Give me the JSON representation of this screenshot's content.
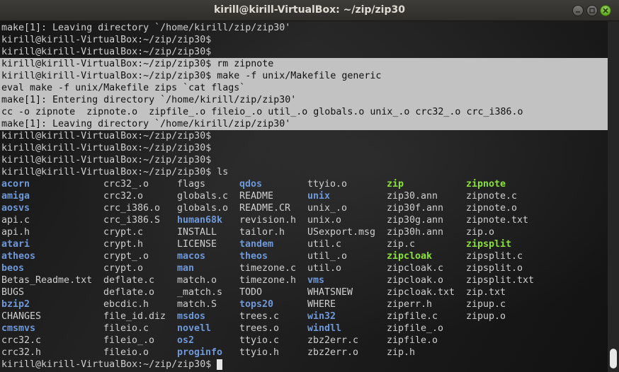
{
  "window": {
    "title": "kirill@kirill-VirtualBox: ~/zip/zip30"
  },
  "colors": {
    "directory": "#6f99d9",
    "executable": "#8ae234",
    "selection": "#c2c2c2"
  },
  "terminal": {
    "lines_before": [
      {
        "text": "make[1]: Leaving directory `/home/kirill/zip/zip30'",
        "selected": false
      },
      {
        "text": "kirill@kirill-VirtualBox:~/zip/zip30$",
        "selected": false
      },
      {
        "text": "kirill@kirill-VirtualBox:~/zip/zip30$",
        "selected": false
      },
      {
        "text": "kirill@kirill-VirtualBox:~/zip/zip30$ rm zipnote",
        "selected": true
      },
      {
        "text": "kirill@kirill-VirtualBox:~/zip/zip30$ make -f unix/Makefile generic",
        "selected": true
      },
      {
        "text": "eval make -f unix/Makefile zips `cat flags`",
        "selected": true
      },
      {
        "text": "make[1]: Entering directory `/home/kirill/zip/zip30'",
        "selected": true
      },
      {
        "text": "cc -o zipnote  zipnote.o  zipfile_.o fileio_.o util_.o globals.o unix_.o crc32_.o crc_i386.o",
        "selected": true
      },
      {
        "text": "make[1]: Leaving directory `/home/kirill/zip/zip30'",
        "selected": true
      },
      {
        "text": "kirill@kirill-VirtualBox:~/zip/zip30$",
        "selected": false
      },
      {
        "text": "kirill@kirill-VirtualBox:~/zip/zip30$",
        "selected": false
      },
      {
        "text": "kirill@kirill-VirtualBox:~/zip/zip30$",
        "selected": false
      },
      {
        "text": "kirill@kirill-VirtualBox:~/zip/zip30$ ls",
        "selected": false
      }
    ],
    "ls_rows": [
      [
        {
          "t": "acorn",
          "k": "dir"
        },
        {
          "t": "crc32_.o",
          "k": "file"
        },
        {
          "t": "flags",
          "k": "file"
        },
        {
          "t": "qdos",
          "k": "dir"
        },
        {
          "t": "ttyio.o",
          "k": "file"
        },
        {
          "t": "zip",
          "k": "exe"
        },
        {
          "t": "zipnote",
          "k": "exe"
        }
      ],
      [
        {
          "t": "amiga",
          "k": "dir"
        },
        {
          "t": "crc32.o",
          "k": "file"
        },
        {
          "t": "globals.c",
          "k": "file"
        },
        {
          "t": "README",
          "k": "file"
        },
        {
          "t": "unix",
          "k": "dir"
        },
        {
          "t": "zip30.ann",
          "k": "file"
        },
        {
          "t": "zipnote.c",
          "k": "file"
        }
      ],
      [
        {
          "t": "aosvs",
          "k": "dir"
        },
        {
          "t": "crc_i386.o",
          "k": "file"
        },
        {
          "t": "globals.o",
          "k": "file"
        },
        {
          "t": "README.CR",
          "k": "file"
        },
        {
          "t": "unix_.o",
          "k": "file"
        },
        {
          "t": "zip30f.ann",
          "k": "file"
        },
        {
          "t": "zipnote.o",
          "k": "file"
        }
      ],
      [
        {
          "t": "api.c",
          "k": "file"
        },
        {
          "t": "crc_i386.S",
          "k": "file"
        },
        {
          "t": "human68k",
          "k": "dir"
        },
        {
          "t": "revision.h",
          "k": "file"
        },
        {
          "t": "unix.o",
          "k": "file"
        },
        {
          "t": "zip30g.ann",
          "k": "file"
        },
        {
          "t": "zipnote.txt",
          "k": "file"
        }
      ],
      [
        {
          "t": "api.h",
          "k": "file"
        },
        {
          "t": "crypt.c",
          "k": "file"
        },
        {
          "t": "INSTALL",
          "k": "file"
        },
        {
          "t": "tailor.h",
          "k": "file"
        },
        {
          "t": "USexport.msg",
          "k": "file"
        },
        {
          "t": "zip30h.ann",
          "k": "file"
        },
        {
          "t": "zip.o",
          "k": "file"
        }
      ],
      [
        {
          "t": "atari",
          "k": "dir"
        },
        {
          "t": "crypt.h",
          "k": "file"
        },
        {
          "t": "LICENSE",
          "k": "file"
        },
        {
          "t": "tandem",
          "k": "dir"
        },
        {
          "t": "util.c",
          "k": "file"
        },
        {
          "t": "zip.c",
          "k": "file"
        },
        {
          "t": "zipsplit",
          "k": "exe"
        }
      ],
      [
        {
          "t": "atheos",
          "k": "dir"
        },
        {
          "t": "crypt_.o",
          "k": "file"
        },
        {
          "t": "macos",
          "k": "dir"
        },
        {
          "t": "theos",
          "k": "dir"
        },
        {
          "t": "util_.o",
          "k": "file"
        },
        {
          "t": "zipcloak",
          "k": "exe"
        },
        {
          "t": "zipsplit.c",
          "k": "file"
        }
      ],
      [
        {
          "t": "beos",
          "k": "dir"
        },
        {
          "t": "crypt.o",
          "k": "file"
        },
        {
          "t": "man",
          "k": "dir"
        },
        {
          "t": "timezone.c",
          "k": "file"
        },
        {
          "t": "util.o",
          "k": "file"
        },
        {
          "t": "zipcloak.c",
          "k": "file"
        },
        {
          "t": "zipsplit.o",
          "k": "file"
        }
      ],
      [
        {
          "t": "Betas_Readme.txt",
          "k": "file"
        },
        {
          "t": "deflate.c",
          "k": "file"
        },
        {
          "t": "match.o",
          "k": "file"
        },
        {
          "t": "timezone.h",
          "k": "file"
        },
        {
          "t": "vms",
          "k": "dir"
        },
        {
          "t": "zipcloak.o",
          "k": "file"
        },
        {
          "t": "zipsplit.txt",
          "k": "file"
        }
      ],
      [
        {
          "t": "BUGS",
          "k": "file"
        },
        {
          "t": "deflate.o",
          "k": "file"
        },
        {
          "t": "_match.s",
          "k": "file"
        },
        {
          "t": "TODO",
          "k": "file"
        },
        {
          "t": "WHATSNEW",
          "k": "file"
        },
        {
          "t": "zipcloak.txt",
          "k": "file"
        },
        {
          "t": "zip.txt",
          "k": "file"
        }
      ],
      [
        {
          "t": "bzip2",
          "k": "dir"
        },
        {
          "t": "ebcdic.h",
          "k": "file"
        },
        {
          "t": "match.S",
          "k": "file"
        },
        {
          "t": "tops20",
          "k": "dir"
        },
        {
          "t": "WHERE",
          "k": "file"
        },
        {
          "t": "ziperr.h",
          "k": "file"
        },
        {
          "t": "zipup.c",
          "k": "file"
        }
      ],
      [
        {
          "t": "CHANGES",
          "k": "file"
        },
        {
          "t": "file_id.diz",
          "k": "file"
        },
        {
          "t": "msdos",
          "k": "dir"
        },
        {
          "t": "trees.c",
          "k": "file"
        },
        {
          "t": "win32",
          "k": "dir"
        },
        {
          "t": "zipfile.c",
          "k": "file"
        },
        {
          "t": "zipup.o",
          "k": "file"
        }
      ],
      [
        {
          "t": "cmsmvs",
          "k": "dir"
        },
        {
          "t": "fileio.c",
          "k": "file"
        },
        {
          "t": "novell",
          "k": "dir"
        },
        {
          "t": "trees.o",
          "k": "file"
        },
        {
          "t": "windll",
          "k": "dir"
        },
        {
          "t": "zipfile_.o",
          "k": "file"
        },
        {
          "t": "",
          "k": "file"
        }
      ],
      [
        {
          "t": "crc32.c",
          "k": "file"
        },
        {
          "t": "fileio_.o",
          "k": "file"
        },
        {
          "t": "os2",
          "k": "dir"
        },
        {
          "t": "ttyio.c",
          "k": "file"
        },
        {
          "t": "zbz2err.c",
          "k": "file"
        },
        {
          "t": "zipfile.o",
          "k": "file"
        },
        {
          "t": "",
          "k": "file"
        }
      ],
      [
        {
          "t": "crc32.h",
          "k": "file"
        },
        {
          "t": "fileio.o",
          "k": "file"
        },
        {
          "t": "proginfo",
          "k": "dir"
        },
        {
          "t": "ttyio.h",
          "k": "file"
        },
        {
          "t": "zbz2err.o",
          "k": "file"
        },
        {
          "t": "zip.h",
          "k": "file"
        },
        {
          "t": "",
          "k": "file"
        }
      ]
    ],
    "final_prompt": "kirill@kirill-VirtualBox:~/zip/zip30$ "
  }
}
